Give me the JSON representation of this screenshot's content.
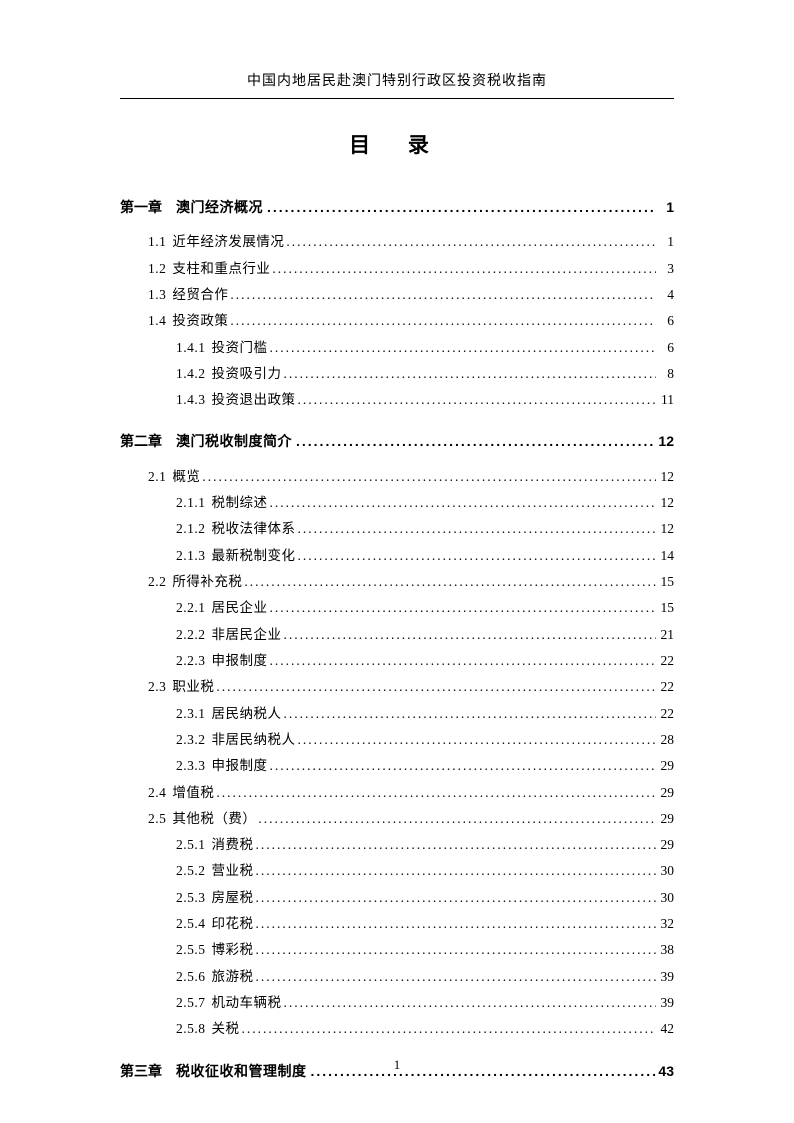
{
  "header": "中国内地居民赴澳门特别行政区投资税收指南",
  "title": "目  录",
  "page_number": "1",
  "toc": [
    {
      "type": "chapter",
      "prefix": "第一章",
      "text": "澳门经济概况",
      "page": "1"
    },
    {
      "type": "gap"
    },
    {
      "type": "section",
      "number": "1.1",
      "text": "近年经济发展情况",
      "page": "1"
    },
    {
      "type": "section",
      "number": "1.2",
      "text": "支柱和重点行业",
      "page": "3"
    },
    {
      "type": "section",
      "number": "1.3",
      "text": "经贸合作",
      "page": "4"
    },
    {
      "type": "section",
      "number": "1.4",
      "text": "投资政策",
      "page": "6"
    },
    {
      "type": "subsection",
      "number": "1.4.1",
      "text": "投资门槛",
      "page": "6"
    },
    {
      "type": "subsection",
      "number": "1.4.2",
      "text": "投资吸引力",
      "page": "8"
    },
    {
      "type": "subsection",
      "number": "1.4.3",
      "text": "投资退出政策",
      "page": "11"
    },
    {
      "type": "chapter",
      "prefix": "第二章",
      "text": "澳门税收制度简介",
      "page": "12"
    },
    {
      "type": "gap"
    },
    {
      "type": "section",
      "number": "2.1",
      "text": "概览",
      "page": "12"
    },
    {
      "type": "subsection",
      "number": "2.1.1",
      "text": "税制综述",
      "page": "12"
    },
    {
      "type": "subsection",
      "number": "2.1.2",
      "text": "税收法律体系",
      "page": "12"
    },
    {
      "type": "subsection",
      "number": "2.1.3",
      "text": "最新税制变化",
      "page": "14"
    },
    {
      "type": "section",
      "number": "2.2",
      "text": "所得补充税",
      "page": "15"
    },
    {
      "type": "subsection",
      "number": "2.2.1",
      "text": "居民企业",
      "page": "15"
    },
    {
      "type": "subsection",
      "number": "2.2.2",
      "text": "非居民企业",
      "page": "21"
    },
    {
      "type": "subsection",
      "number": "2.2.3",
      "text": "申报制度",
      "page": "22"
    },
    {
      "type": "section",
      "number": "2.3",
      "text": "职业税",
      "page": "22"
    },
    {
      "type": "subsection",
      "number": "2.3.1",
      "text": "居民纳税人",
      "page": "22"
    },
    {
      "type": "subsection",
      "number": "2.3.2",
      "text": "非居民纳税人",
      "page": "28"
    },
    {
      "type": "subsection",
      "number": "2.3.3",
      "text": "申报制度",
      "page": "29"
    },
    {
      "type": "section",
      "number": "2.4",
      "text": "增值税",
      "page": "29"
    },
    {
      "type": "section",
      "number": "2.5",
      "text": "其他税（费）",
      "page": "29"
    },
    {
      "type": "subsection",
      "number": "2.5.1",
      "text": "消费税",
      "page": "29"
    },
    {
      "type": "subsection",
      "number": "2.5.2",
      "text": "营业税",
      "page": "30"
    },
    {
      "type": "subsection",
      "number": "2.5.3",
      "text": "房屋税",
      "page": "30"
    },
    {
      "type": "subsection",
      "number": "2.5.4",
      "text": "印花税",
      "page": "32"
    },
    {
      "type": "subsection",
      "number": "2.5.5",
      "text": "博彩税",
      "page": "38"
    },
    {
      "type": "subsection",
      "number": "2.5.6",
      "text": "旅游税",
      "page": "39"
    },
    {
      "type": "subsection",
      "number": "2.5.7",
      "text": "机动车辆税",
      "page": "39"
    },
    {
      "type": "subsection",
      "number": "2.5.8",
      "text": "关税",
      "page": "42"
    },
    {
      "type": "chapter",
      "prefix": "第三章",
      "text": "税收征收和管理制度",
      "page": "43"
    }
  ]
}
